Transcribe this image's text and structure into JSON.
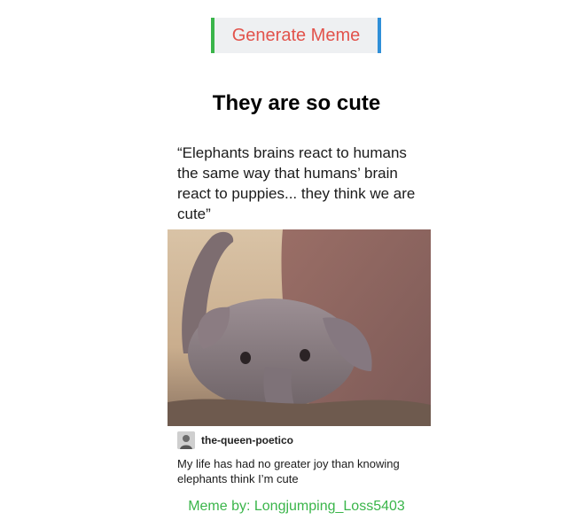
{
  "button": {
    "label": "Generate Meme",
    "text_color": "#e2534c",
    "left_border_color": "#3ab54a",
    "right_border_color": "#2f8fd8"
  },
  "meme": {
    "title": "They are so cute",
    "image": {
      "top_caption": "“Elephants brains react to humans the same way that humans’ brain react to puppies... they think we are cute”",
      "poster_name": "the-queen-poetico",
      "bottom_caption": "My life has had no greater joy than knowing elephants think I’m cute",
      "avatar_icon": "avatar-icon",
      "photo_subject": "baby-elephant-photo"
    }
  },
  "credit": {
    "text": "Meme by: Longjumping_Loss5403",
    "color": "#3ab54a"
  }
}
